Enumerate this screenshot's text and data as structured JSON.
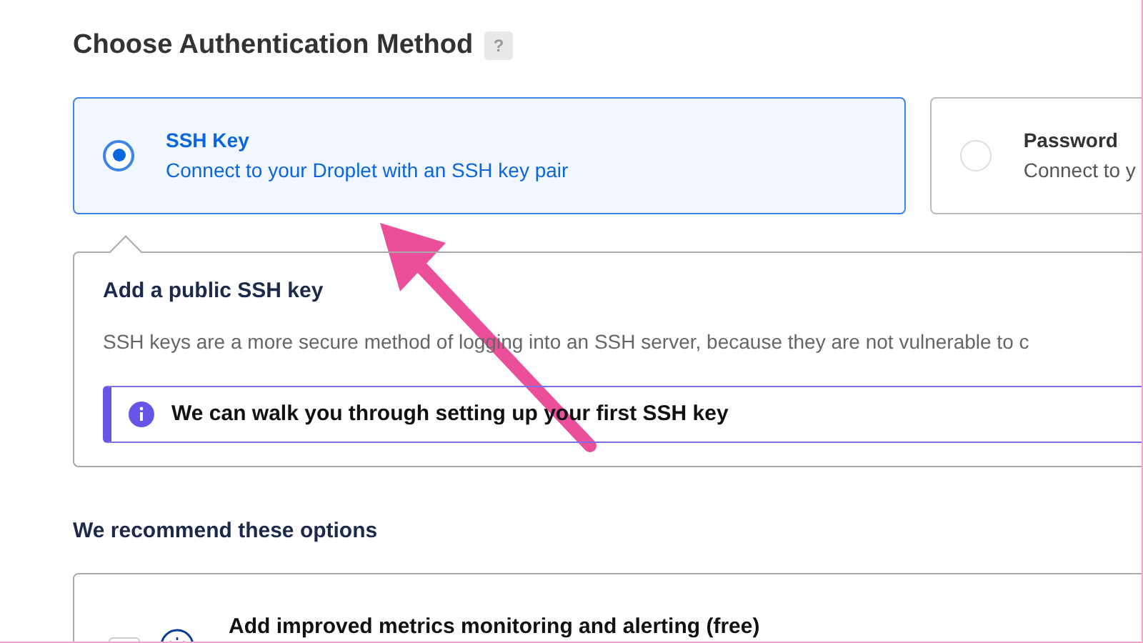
{
  "title": "Choose Authentication Method",
  "help": "?",
  "methods": [
    {
      "label": "SSH Key",
      "description": "Connect to your Droplet with an SSH key pair",
      "selected": true
    },
    {
      "label": "Password",
      "description": "Connect to y",
      "selected": false
    }
  ],
  "panel": {
    "title": "Add a public SSH key",
    "text": "SSH keys are a more secure method of logging into an SSH server, because they are not vulnerable to c",
    "notice": "We can walk you through setting up your first SSH key"
  },
  "recommend": {
    "title": "We recommend these options",
    "options": [
      {
        "label": "Add improved metrics monitoring and alerting (free)",
        "checked": false
      }
    ]
  }
}
